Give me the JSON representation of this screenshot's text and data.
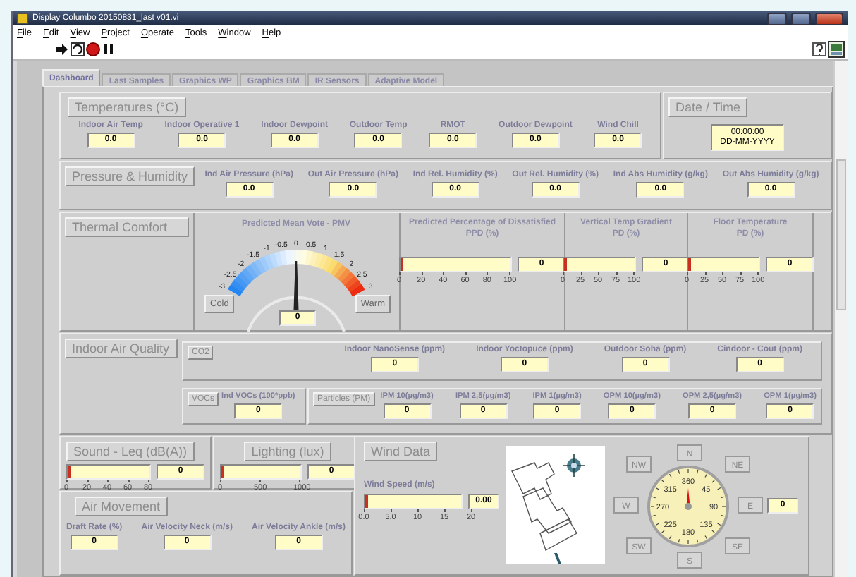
{
  "window": {
    "title": "Display Columbo 20150831_last v01.vi"
  },
  "menu": [
    "File",
    "Edit",
    "View",
    "Project",
    "Operate",
    "Tools",
    "Window",
    "Help"
  ],
  "tabs": [
    {
      "label": "Dashboard",
      "selected": true
    },
    {
      "label": "Last Samples",
      "selected": false
    },
    {
      "label": "Graphics WP",
      "selected": false
    },
    {
      "label": "Graphics BM",
      "selected": false
    },
    {
      "label": "IR Sensors",
      "selected": false
    },
    {
      "label": "Adaptive Model",
      "selected": false
    }
  ],
  "temperatures": {
    "title": "Temperatures (°C)",
    "fields": [
      {
        "label": "Indoor Air Temp",
        "value": "0.0"
      },
      {
        "label": "Indoor Operative 1",
        "value": "0.0"
      },
      {
        "label": "Indoor Dewpoint",
        "value": "0.0"
      },
      {
        "label": "Outdoor Temp",
        "value": "0.0"
      },
      {
        "label": "RMOT",
        "value": "0.0"
      },
      {
        "label": "Outdoor Dewpoint",
        "value": "0.0"
      },
      {
        "label": "Wind Chill",
        "value": "0.0"
      }
    ]
  },
  "date_time": {
    "title": "Date / Time",
    "time": "00:00:00",
    "date": "DD-MM-YYYY"
  },
  "pressure_humidity": {
    "title": "Pressure & Humidity",
    "fields": [
      {
        "label": "Ind Air Pressure (hPa)",
        "value": "0.0"
      },
      {
        "label": "Out Air Pressure (hPa)",
        "value": "0.0"
      },
      {
        "label": "Ind Rel. Humidity (%)",
        "value": "0.0"
      },
      {
        "label": "Out Rel. Humidity (%)",
        "value": "0.0"
      },
      {
        "label": "Ind Abs Humidity (g/kg)",
        "value": "0.0"
      },
      {
        "label": "Out Abs Humidity (g/kg)",
        "value": "0.0"
      }
    ]
  },
  "thermal_comfort": {
    "title": "Thermal Comfort",
    "pmv": {
      "title": "Predicted Mean Vote - PMV",
      "ticks": [
        "-3",
        "-2.5",
        "-2",
        "-1.5",
        "-1",
        "-0.5",
        "0",
        "0.5",
        "1",
        "1.5",
        "2",
        "2.5",
        "3"
      ],
      "value": "0",
      "cold": "Cold",
      "warm": "Warm"
    },
    "meters": [
      {
        "title": "Predicted Percentage of Dissatisfied",
        "subtitle": "PPD (%)",
        "value": "0",
        "level": 0,
        "ticks": [
          "0",
          "20",
          "40",
          "60",
          "80",
          "100"
        ]
      },
      {
        "title": "Vertical Temp Gradient",
        "subtitle": "PD (%)",
        "value": "0",
        "level": 0,
        "ticks": [
          "0",
          "25",
          "50",
          "75",
          "100"
        ]
      },
      {
        "title": "Floor Temperature",
        "subtitle": "PD (%)",
        "value": "0",
        "level": 0,
        "ticks": [
          "0",
          "25",
          "50",
          "75",
          "100"
        ]
      }
    ]
  },
  "indoor_air_quality": {
    "title": "Indoor Air Quality",
    "groups": [
      {
        "label": "CO2",
        "fields": [
          {
            "label": "Indoor NanoSense (ppm)",
            "value": "0"
          },
          {
            "label": "Indoor Yoctopuce (ppm)",
            "value": "0"
          },
          {
            "label": "Outdoor Soha (ppm)",
            "value": "0"
          },
          {
            "label": "Cindoor - Cout (ppm)",
            "value": "0"
          }
        ]
      },
      {
        "label": "VOCs",
        "fields": [
          {
            "label": "Ind VOCs (100*ppb)",
            "value": "0"
          }
        ]
      },
      {
        "label": "Particles (PM)",
        "fields": [
          {
            "label": "IPM 10(µg/m3)",
            "value": "0"
          },
          {
            "label": "IPM 2,5(µg/m3)",
            "value": "0"
          },
          {
            "label": "IPM 1(µg/m3)",
            "value": "0"
          },
          {
            "label": "OPM 10(µg/m3)",
            "value": "0"
          },
          {
            "label": "OPM 2,5(µg/m3)",
            "value": "0"
          },
          {
            "label": "OPM 1(µg/m3)",
            "value": "0"
          }
        ]
      }
    ]
  },
  "sound": {
    "title": "Sound - Leq (dB(A))",
    "value": "0",
    "level": 0,
    "ticks": [
      "0",
      "20",
      "40",
      "60",
      "80"
    ]
  },
  "lighting": {
    "title": "Lighting (lux)",
    "value": "0",
    "level": 0,
    "ticks": [
      "0",
      "500",
      "1000"
    ]
  },
  "air_movement": {
    "title": "Air Movement",
    "fields": [
      {
        "label": "Draft Rate (%)",
        "value": "0"
      },
      {
        "label": "Air Velocity Neck (m/s)",
        "value": "0"
      },
      {
        "label": "Air Velocity Ankle (m/s)",
        "value": "0"
      }
    ]
  },
  "wind": {
    "title": "Wind Data",
    "speed": {
      "label": "Wind Speed (m/s)",
      "value": "0.00",
      "level": 0,
      "ticks": [
        "0.0",
        "5.0",
        "10",
        "15",
        "20"
      ]
    },
    "directions": [
      "N",
      "NE",
      "E",
      "SE",
      "S",
      "SW",
      "W",
      "NW"
    ],
    "dial_labels": [
      "360",
      "45",
      "90",
      "135",
      "180",
      "225",
      "270",
      "315"
    ],
    "value": "0"
  }
}
